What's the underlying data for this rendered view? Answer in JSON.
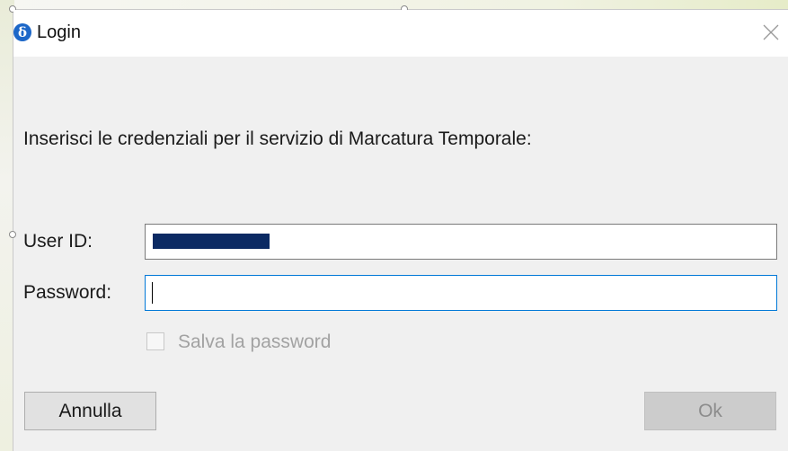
{
  "window": {
    "title": "Login",
    "app_icon_glyph": "δ",
    "close_icon": "close-icon"
  },
  "form": {
    "prompt": "Inserisci le credenziali per il servizio di Marcatura Temporale:",
    "userid_label": "User ID:",
    "userid_value": "",
    "userid_redacted": true,
    "password_label": "Password:",
    "password_value": "",
    "password_focused": true,
    "save_password_label": "Salva la password",
    "save_password_checked": false,
    "save_password_enabled": false
  },
  "buttons": {
    "cancel_label": "Annulla",
    "ok_label": "Ok",
    "ok_enabled": false
  },
  "colors": {
    "dialog_bg": "#f0f0f0",
    "titlebar_bg": "#ffffff",
    "focus_border": "#0078d7",
    "redaction": "#0b2a63",
    "app_icon": "#1c67c8"
  }
}
